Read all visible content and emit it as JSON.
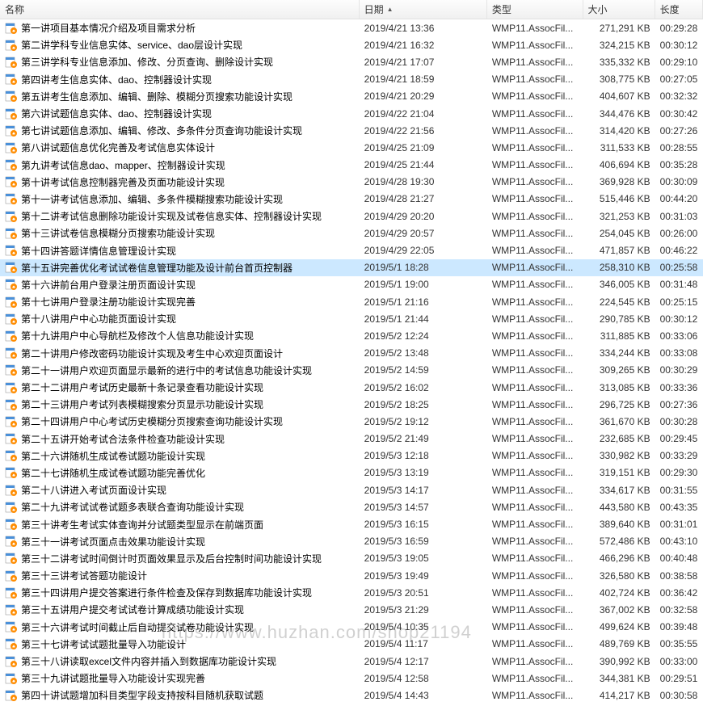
{
  "columns": {
    "name": "名称",
    "date": "日期",
    "type": "类型",
    "size": "大小",
    "length": "长度"
  },
  "selected_index": 14,
  "watermark": "https://www.huzhan.com/shop21194",
  "files": [
    {
      "name": "第一讲项目基本情况介绍及项目需求分析",
      "date": "2019/4/21 13:36",
      "type": "WMP11.AssocFil...",
      "size": "271,291 KB",
      "length": "00:29:28"
    },
    {
      "name": "第二讲学科专业信息实体、service、dao层设计实现",
      "date": "2019/4/21 16:32",
      "type": "WMP11.AssocFil...",
      "size": "324,215 KB",
      "length": "00:30:12"
    },
    {
      "name": "第三讲学科专业信息添加、修改、分页查询、删除设计实现",
      "date": "2019/4/21 17:07",
      "type": "WMP11.AssocFil...",
      "size": "335,332 KB",
      "length": "00:29:10"
    },
    {
      "name": "第四讲考生信息实体、dao、控制器设计实现",
      "date": "2019/4/21 18:59",
      "type": "WMP11.AssocFil...",
      "size": "308,775 KB",
      "length": "00:27:05"
    },
    {
      "name": "第五讲考生信息添加、编辑、删除、模糊分页搜索功能设计实现",
      "date": "2019/4/21 20:29",
      "type": "WMP11.AssocFil...",
      "size": "404,607 KB",
      "length": "00:32:32"
    },
    {
      "name": "第六讲试题信息实体、dao、控制器设计实现",
      "date": "2019/4/22 21:04",
      "type": "WMP11.AssocFil...",
      "size": "344,476 KB",
      "length": "00:30:42"
    },
    {
      "name": "第七讲试题信息添加、编辑、修改、多条件分页查询功能设计实现",
      "date": "2019/4/22 21:56",
      "type": "WMP11.AssocFil...",
      "size": "314,420 KB",
      "length": "00:27:26"
    },
    {
      "name": "第八讲试题信息优化完善及考试信息实体设计",
      "date": "2019/4/25 21:09",
      "type": "WMP11.AssocFil...",
      "size": "311,533 KB",
      "length": "00:28:55"
    },
    {
      "name": "第九讲考试信息dao、mapper、控制器设计实现",
      "date": "2019/4/25 21:44",
      "type": "WMP11.AssocFil...",
      "size": "406,694 KB",
      "length": "00:35:28"
    },
    {
      "name": "第十讲考试信息控制器完善及页面功能设计实现",
      "date": "2019/4/28 19:30",
      "type": "WMP11.AssocFil...",
      "size": "369,928 KB",
      "length": "00:30:09"
    },
    {
      "name": "第十一讲考试信息添加、编辑、多条件模糊搜索功能设计实现",
      "date": "2019/4/28 21:27",
      "type": "WMP11.AssocFil...",
      "size": "515,446 KB",
      "length": "00:44:20"
    },
    {
      "name": "第十二讲考试信息删除功能设计实现及试卷信息实体、控制器设计实现",
      "date": "2019/4/29 20:20",
      "type": "WMP11.AssocFil...",
      "size": "321,253 KB",
      "length": "00:31:03"
    },
    {
      "name": "第十三讲试卷信息模糊分页搜索功能设计实现",
      "date": "2019/4/29 20:57",
      "type": "WMP11.AssocFil...",
      "size": "254,045 KB",
      "length": "00:26:00"
    },
    {
      "name": "第十四讲答题详情信息管理设计实现",
      "date": "2019/4/29 22:05",
      "type": "WMP11.AssocFil...",
      "size": "471,857 KB",
      "length": "00:46:22"
    },
    {
      "name": "第十五讲完善优化考试试卷信息管理功能及设计前台首页控制器",
      "date": "2019/5/1 18:28",
      "type": "WMP11.AssocFil...",
      "size": "258,310 KB",
      "length": "00:25:58"
    },
    {
      "name": "第十六讲前台用户登录注册页面设计实现",
      "date": "2019/5/1 19:00",
      "type": "WMP11.AssocFil...",
      "size": "346,005 KB",
      "length": "00:31:48"
    },
    {
      "name": "第十七讲用户登录注册功能设计实现完善",
      "date": "2019/5/1 21:16",
      "type": "WMP11.AssocFil...",
      "size": "224,545 KB",
      "length": "00:25:15"
    },
    {
      "name": "第十八讲用户中心功能页面设计实现",
      "date": "2019/5/1 21:44",
      "type": "WMP11.AssocFil...",
      "size": "290,785 KB",
      "length": "00:30:12"
    },
    {
      "name": "第十九讲用户中心导航栏及修改个人信息功能设计实现",
      "date": "2019/5/2 12:24",
      "type": "WMP11.AssocFil...",
      "size": "311,885 KB",
      "length": "00:33:06"
    },
    {
      "name": "第二十讲用户修改密码功能设计实现及考生中心欢迎页面设计",
      "date": "2019/5/2 13:48",
      "type": "WMP11.AssocFil...",
      "size": "334,244 KB",
      "length": "00:33:08"
    },
    {
      "name": "第二十一讲用户欢迎页面显示最新的进行中的考试信息功能设计实现",
      "date": "2019/5/2 14:59",
      "type": "WMP11.AssocFil...",
      "size": "309,265 KB",
      "length": "00:30:29"
    },
    {
      "name": "第二十二讲用户考试历史最新十条记录查看功能设计实现",
      "date": "2019/5/2 16:02",
      "type": "WMP11.AssocFil...",
      "size": "313,085 KB",
      "length": "00:33:36"
    },
    {
      "name": "第二十三讲用户考试列表模糊搜索分页显示功能设计实现",
      "date": "2019/5/2 18:25",
      "type": "WMP11.AssocFil...",
      "size": "296,725 KB",
      "length": "00:27:36"
    },
    {
      "name": "第二十四讲用户中心考试历史模糊分页搜索查询功能设计实现",
      "date": "2019/5/2 19:12",
      "type": "WMP11.AssocFil...",
      "size": "361,670 KB",
      "length": "00:30:28"
    },
    {
      "name": "第二十五讲开始考试合法条件检查功能设计实现",
      "date": "2019/5/2 21:49",
      "type": "WMP11.AssocFil...",
      "size": "232,685 KB",
      "length": "00:29:45"
    },
    {
      "name": "第二十六讲随机生成试卷试题功能设计实现",
      "date": "2019/5/3 12:18",
      "type": "WMP11.AssocFil...",
      "size": "330,982 KB",
      "length": "00:33:29"
    },
    {
      "name": "第二十七讲随机生成试卷试题功能完善优化",
      "date": "2019/5/3 13:19",
      "type": "WMP11.AssocFil...",
      "size": "319,151 KB",
      "length": "00:29:30"
    },
    {
      "name": "第二十八讲进入考试页面设计实现",
      "date": "2019/5/3 14:17",
      "type": "WMP11.AssocFil...",
      "size": "334,617 KB",
      "length": "00:31:55"
    },
    {
      "name": "第二十九讲考试试卷试题多表联合查询功能设计实现",
      "date": "2019/5/3 14:57",
      "type": "WMP11.AssocFil...",
      "size": "443,580 KB",
      "length": "00:43:35"
    },
    {
      "name": "第三十讲考生考试实体查询并分试题类型显示在前端页面",
      "date": "2019/5/3 16:15",
      "type": "WMP11.AssocFil...",
      "size": "389,640 KB",
      "length": "00:31:01"
    },
    {
      "name": "第三十一讲考试页面点击效果功能设计实现",
      "date": "2019/5/3 16:59",
      "type": "WMP11.AssocFil...",
      "size": "572,486 KB",
      "length": "00:43:10"
    },
    {
      "name": "第三十二讲考试时间倒计时页面效果显示及后台控制时间功能设计实现",
      "date": "2019/5/3 19:05",
      "type": "WMP11.AssocFil...",
      "size": "466,296 KB",
      "length": "00:40:48"
    },
    {
      "name": "第三十三讲考试答题功能设计",
      "date": "2019/5/3 19:49",
      "type": "WMP11.AssocFil...",
      "size": "326,580 KB",
      "length": "00:38:58"
    },
    {
      "name": "第三十四讲用户提交答案进行条件检查及保存到数据库功能设计实现",
      "date": "2019/5/3 20:51",
      "type": "WMP11.AssocFil...",
      "size": "402,724 KB",
      "length": "00:36:42"
    },
    {
      "name": "第三十五讲用户提交考试试卷计算成绩功能设计实现",
      "date": "2019/5/3 21:29",
      "type": "WMP11.AssocFil...",
      "size": "367,002 KB",
      "length": "00:32:58"
    },
    {
      "name": "第三十六讲考试时间截止后自动提交试卷功能设计实现",
      "date": "2019/5/4 10:35",
      "type": "WMP11.AssocFil...",
      "size": "499,624 KB",
      "length": "00:39:48"
    },
    {
      "name": "第三十七讲考试试题批量导入功能设计",
      "date": "2019/5/4 11:17",
      "type": "WMP11.AssocFil...",
      "size": "489,769 KB",
      "length": "00:35:55"
    },
    {
      "name": "第三十八讲读取excel文件内容并插入到数据库功能设计实现",
      "date": "2019/5/4 12:17",
      "type": "WMP11.AssocFil...",
      "size": "390,992 KB",
      "length": "00:33:00"
    },
    {
      "name": "第三十九讲试题批量导入功能设计实现完善",
      "date": "2019/5/4 12:58",
      "type": "WMP11.AssocFil...",
      "size": "344,381 KB",
      "length": "00:29:51"
    },
    {
      "name": "第四十讲试题增加科目类型字段支持按科目随机获取试题",
      "date": "2019/5/4 14:43",
      "type": "WMP11.AssocFil...",
      "size": "414,217 KB",
      "length": "00:30:58"
    }
  ]
}
